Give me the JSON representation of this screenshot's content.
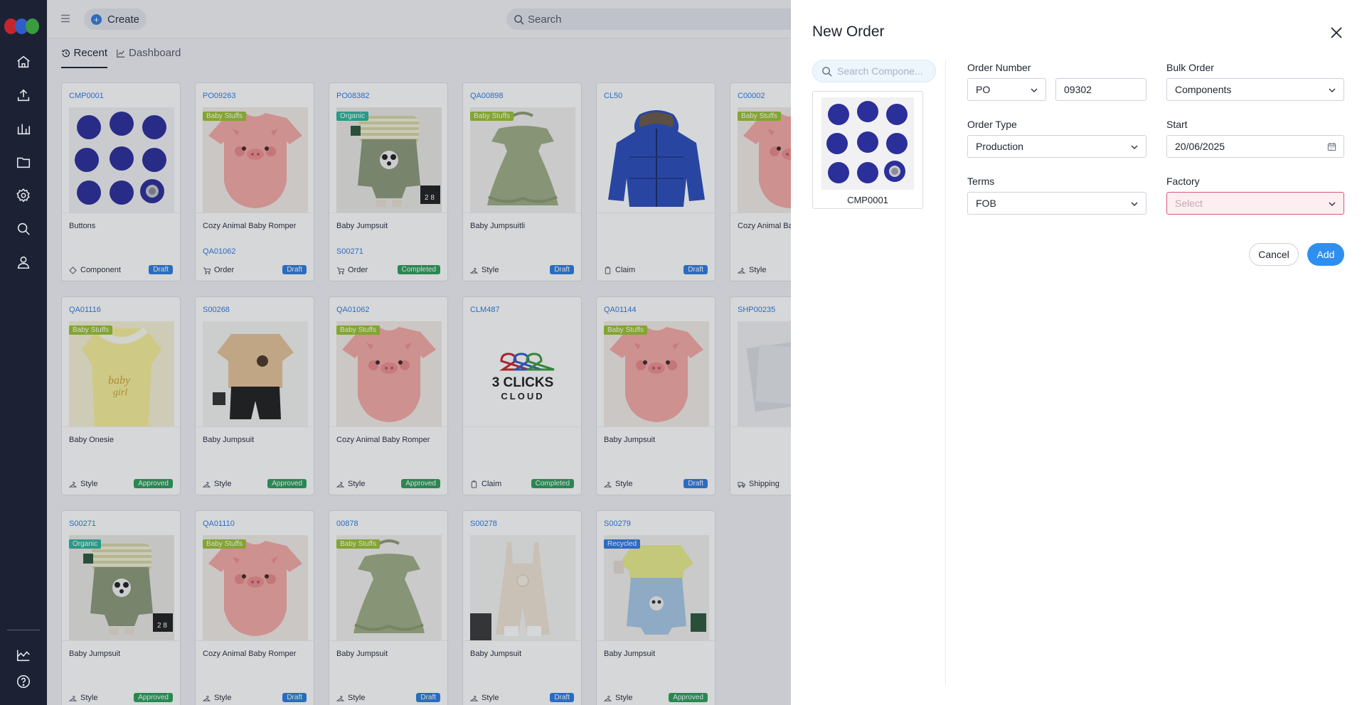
{
  "topbar": {
    "create_label": "Create",
    "search_placeholder": "Search"
  },
  "tabs": [
    {
      "label": "Recent"
    },
    {
      "label": "Dashboard"
    }
  ],
  "colors": {
    "accent": "#2f7de1",
    "draft": "#2f7de1",
    "approved": "#2e9e5b",
    "completed": "#2e9e5b",
    "baby_stuffs": "#9ac233",
    "organic": "#2db59b",
    "recycled": "#2f7de1",
    "sidebar": "#1c2233"
  },
  "cards": [
    {
      "code": "CMP0001",
      "name": "Buttons",
      "sub": "",
      "type": "Component",
      "type_icon": "diamond-icon",
      "status": "Draft",
      "tag": "",
      "image": "buttons"
    },
    {
      "code": "PO09263",
      "name": "Cozy Animal Baby Romper",
      "sub": "QA01062",
      "type": "Order",
      "type_icon": "cart-icon",
      "status": "Draft",
      "tag": "Baby Stuffs",
      "image": "pig"
    },
    {
      "code": "PO08382",
      "name": "Baby Jumpsuit",
      "sub": "S00271",
      "type": "Order",
      "type_icon": "cart-icon",
      "status": "Completed",
      "tag": "Organic",
      "image": "jumpsuit"
    },
    {
      "code": "QA00898",
      "name": "Baby Jumpsuitli",
      "sub": "",
      "type": "Style",
      "type_icon": "hanger-icon",
      "status": "Draft",
      "tag": "Baby Stuffs",
      "image": "dress"
    },
    {
      "code": "CL50",
      "name": "",
      "sub": "",
      "type": "Claim",
      "type_icon": "clipboard-icon",
      "status": "Draft",
      "tag": "",
      "image": "jacket"
    },
    {
      "code": "C00002",
      "name": "Cozy Animal Ba",
      "sub": "",
      "type": "Style",
      "type_icon": "hanger-icon",
      "status": "",
      "tag": "Baby Stuffs",
      "image": "pig"
    },
    {
      "code": "QA01116",
      "name": "Baby Onesie",
      "sub": "",
      "type": "Style",
      "type_icon": "hanger-icon",
      "status": "Approved",
      "tag": "Baby Stuffs",
      "image": "onesie"
    },
    {
      "code": "S00268",
      "name": "Baby Jumpsuit",
      "sub": "",
      "type": "Style",
      "type_icon": "hanger-icon",
      "status": "Approved",
      "tag": "",
      "image": "tee"
    },
    {
      "code": "QA01062",
      "name": "Cozy Animal Baby Romper",
      "sub": "",
      "type": "Style",
      "type_icon": "hanger-icon",
      "status": "Approved",
      "tag": "Baby Stuffs",
      "image": "pig"
    },
    {
      "code": "CLM487",
      "name": "",
      "sub": "",
      "type": "Claim",
      "type_icon": "clipboard-icon",
      "status": "Completed",
      "tag": "",
      "image": "logo"
    },
    {
      "code": "QA01144",
      "name": "Baby Jumpsuit",
      "sub": "",
      "type": "Style",
      "type_icon": "hanger-icon",
      "status": "Draft",
      "tag": "Baby Stuffs",
      "image": "pig"
    },
    {
      "code": "SHP00235",
      "name": "",
      "sub": "",
      "type": "Shipping",
      "type_icon": "truck-icon",
      "status": "",
      "tag": "",
      "image": "shipping"
    },
    {
      "code": "S00271",
      "name": "Baby Jumpsuit",
      "sub": "",
      "type": "Style",
      "type_icon": "hanger-icon",
      "status": "Approved",
      "tag": "Organic",
      "image": "jumpsuit"
    },
    {
      "code": "QA01110",
      "name": "Cozy Animal Baby Romper",
      "sub": "",
      "type": "Style",
      "type_icon": "hanger-icon",
      "status": "Draft",
      "tag": "Baby Stuffs",
      "image": "pig"
    },
    {
      "code": "00878",
      "name": "Baby Jumpsuit",
      "sub": "",
      "type": "Style",
      "type_icon": "hanger-icon",
      "status": "Draft",
      "tag": "Baby Stuffs",
      "image": "dress"
    },
    {
      "code": "S00278",
      "name": "Baby Jumpsuit",
      "sub": "",
      "type": "Style",
      "type_icon": "hanger-icon",
      "status": "Draft",
      "tag": "",
      "image": "overall"
    },
    {
      "code": "S00279",
      "name": "Baby Jumpsuit",
      "sub": "",
      "type": "Style",
      "type_icon": "hanger-icon",
      "status": "Approved",
      "tag": "Recycled",
      "image": "denim"
    }
  ],
  "logo_card": {
    "line1": "3 CLICKS",
    "line2": "CLOUD"
  },
  "panel": {
    "title": "New Order",
    "component_search_placeholder": "Search Compone...",
    "component": {
      "code": "CMP0001"
    },
    "order_number": {
      "label": "Order Number",
      "prefix": "PO",
      "value": "09302"
    },
    "bulk_order": {
      "label": "Bulk Order",
      "value": "Components"
    },
    "order_type": {
      "label": "Order Type",
      "value": "Production"
    },
    "start": {
      "label": "Start",
      "value": "20/06/2025"
    },
    "terms": {
      "label": "Terms",
      "value": "FOB"
    },
    "factory": {
      "label": "Factory",
      "placeholder": "Select"
    },
    "cancel_label": "Cancel",
    "add_label": "Add"
  }
}
